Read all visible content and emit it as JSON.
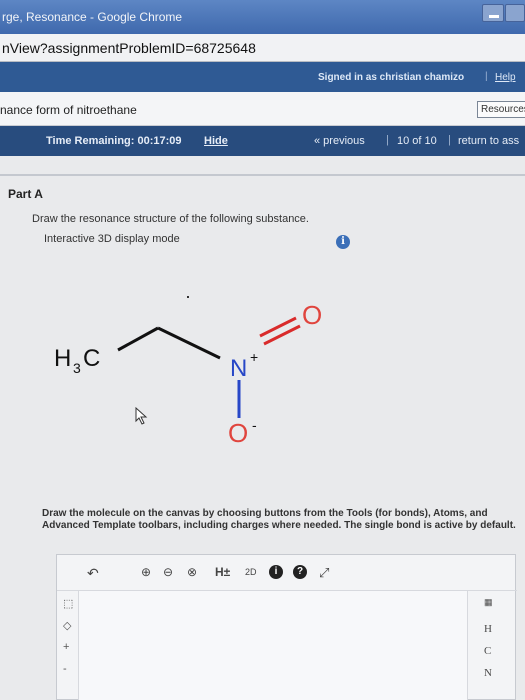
{
  "window": {
    "title": "rge, Resonance - Google Chrome",
    "url": "nView?assignmentProblemID=68725648"
  },
  "header": {
    "signed_in": "Signed in as christian chamizo",
    "help": "Help"
  },
  "assignment": {
    "name": "nance form of nitroethane",
    "resources": "Resources"
  },
  "nav": {
    "time_label": "Time Remaining: 00:17:09",
    "hide": "Hide",
    "previous": "« previous",
    "count": "10 of 10",
    "return": "return to ass",
    "separator": "|"
  },
  "problem": {
    "part": "Part A",
    "instruction": "Draw the resonance structure of the following substance.",
    "mode": "Interactive 3D display mode",
    "info": "i",
    "help_text": "Draw the molecule on the canvas by choosing buttons from the Tools (for bonds), Atoms, and Advanced Template toolbars, including charges where needed. The single bond is active by default."
  },
  "molecule": {
    "methyl": "H",
    "methyl_sub": "3",
    "methyl_c": "C",
    "nitrogen": "N",
    "plus": "+",
    "oxygen_double": "O",
    "oxygen_single": "O",
    "minus": "-",
    "dot": "·",
    "bond_color": "#d92b2b",
    "oxygen_color": "#e0453e",
    "nitrogen_color": "#2747c7"
  },
  "editor": {
    "toolbar": {
      "undo": "↶",
      "zoom_in": "⊕",
      "zoom_out": "⊖",
      "zoom_reset": "⊗",
      "hydrogens": "H±",
      "template": "2D",
      "info": "i",
      "help": "?",
      "expand": "⤢"
    },
    "atoms": [
      "H",
      "C",
      "N"
    ]
  }
}
